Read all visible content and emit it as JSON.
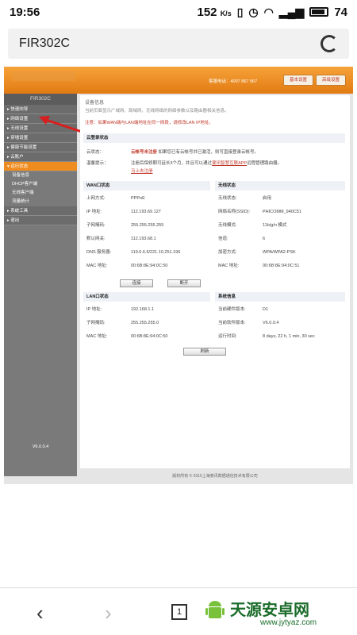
{
  "status": {
    "time": "19:56",
    "network_speed": "152",
    "speed_unit": "K/s",
    "battery": "74"
  },
  "browser": {
    "title": "FIR302C",
    "refresh_icon": "refresh-icon"
  },
  "router": {
    "header": {
      "phone": "客服电话：4007 867 567",
      "btn_basic": "基本设置",
      "btn_advanced": "高级设置"
    },
    "sidebar": {
      "brand": "FIR302C",
      "items": [
        "快速向导",
        "网络设置",
        "无线设置",
        "穿墙设置",
        "健康节能设置",
        "云账户",
        "运行状态"
      ],
      "subitems": [
        "设备信息",
        "DHCP客户端",
        "无线客户端",
        "流量统计"
      ],
      "items2": [
        "系统工具",
        "退出"
      ],
      "version": "V6.0.0.4"
    },
    "content": {
      "title": "设备信息",
      "desc": "当前页面显示广域网、局域网、无线网络的网络参数以及路由器相关信息。",
      "note": "注意：如果WAN端与LAN端地址在同一网段，请修改LAN IP地址。",
      "cloud": {
        "heading": "云登录状态",
        "status_label": "云状态：",
        "status_value": "云帐号未注册",
        "status_tail": "如果您已有云帐号并已激活，则可直接登录云帐号。",
        "tip_label": "温馨提示：",
        "tip_text": "注册后保修期可延长3个月，并且可以通过",
        "tip_link1": "斐讯智慧互联APP",
        "tip_text2": "远程管理路由器。",
        "tip_link2": "马上去注册"
      },
      "wan": {
        "heading": "WAN口状态",
        "rows": [
          [
            "上网方式:",
            "PPPoE"
          ],
          [
            "IP 地址:",
            "112.193.69.127"
          ],
          [
            "子网掩码:",
            "255.255.255.255"
          ],
          [
            "默认网关:",
            "112.193.68.1"
          ],
          [
            "DNS 服务器:",
            "119.6.6.6/221.10.251.196"
          ],
          [
            "MAC 地址:",
            "00:6B:8E:94:0C:50"
          ]
        ],
        "btn_connect": "连接",
        "btn_disconnect": "断开"
      },
      "wireless": {
        "heading": "无线状态",
        "rows": [
          [
            "无线状态:",
            "启用"
          ],
          [
            "网络名称(SSID):",
            "PHICOMM_940C51"
          ],
          [
            "无线模式:",
            "11b/g/n 模式"
          ],
          [
            "信道:",
            "6"
          ],
          [
            "加密方式:",
            "WPA/WPA2-PSK"
          ],
          [
            "MAC 地址:",
            "00:6B:8E:94:0C:51"
          ]
        ]
      },
      "lan": {
        "heading": "LAN口状态",
        "rows": [
          [
            "IP 地址:",
            "192.168.1.1"
          ],
          [
            "子网掩码:",
            "255.255.255.0"
          ],
          [
            "MAC 地址:",
            "00:6B:8E:94:0C:50"
          ]
        ]
      },
      "system": {
        "heading": "系统信息",
        "rows": [
          [
            "当前硬件版本:",
            "D1"
          ],
          [
            "当前软件版本:",
            "V6.0.0.4"
          ],
          [
            "运行时间:",
            "8 days, 22 h, 1 min, 30 sec"
          ]
        ]
      },
      "refresh": "刷新"
    },
    "footer": "版权所有 © 2015上海斐讯数据通信技术有限公司"
  },
  "bottom": {
    "tab_count": "1",
    "brand": "天源安卓网",
    "url": "www.jytyaz.com"
  }
}
